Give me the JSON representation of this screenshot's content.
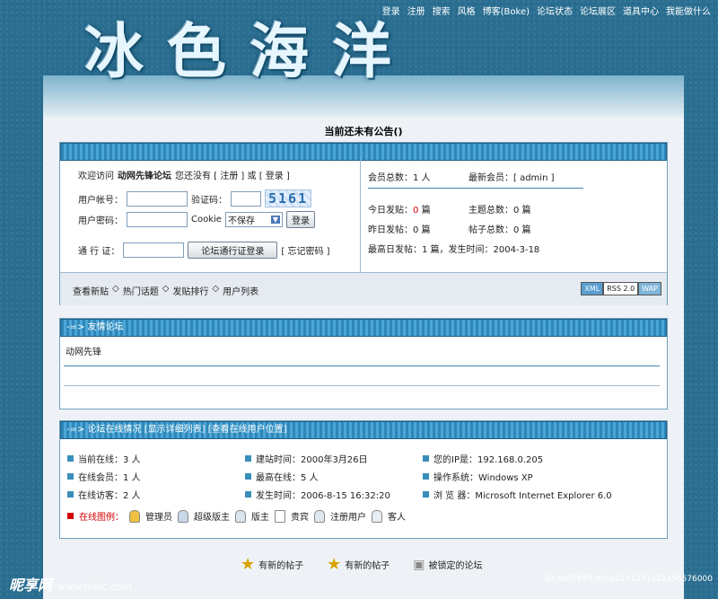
{
  "top_nav": [
    "登录",
    "注册",
    "搜索",
    "风格",
    "博客(Boke)",
    "论坛状态",
    "论坛展区",
    "道具中心",
    "我能做什么"
  ],
  "logo_chars": [
    "冰",
    "色",
    "海",
    "洋"
  ],
  "notice": "当前还未有公告()",
  "login": {
    "welcome_prefix": "欢迎访问",
    "forum_name": "动网先锋论坛",
    "welcome_suffix": "您还没有 [ 注册 ] 或 [ 登录 ]",
    "username_label": "用户帐号：",
    "captcha_label": "验证码：",
    "captcha_value": "5161",
    "password_label": "用户密码：",
    "cookie_label": "Cookie",
    "cookie_option": "不保存",
    "login_button": "登录",
    "passport_label": "通 行 证：",
    "passport_button": "论坛通行证登录",
    "forgot_password": "[ 忘记密码 ]"
  },
  "stats": {
    "members": "会员总数：1 人",
    "newest_member": "最新会员：[ admin ]",
    "today_posts_label": "今日发贴：",
    "today_posts_value": "0",
    "today_posts_unit": "篇",
    "topics": "主题总数：0 篇",
    "yesterday_posts": "昨日发帖：0 篇",
    "posts_total": "帖子总数：0 篇",
    "max_day": "最高日发帖：1 篇，发生时间：2004-3-18"
  },
  "quick_links": [
    "查看新贴",
    "热门话题",
    "发贴排行",
    "用户列表"
  ],
  "quick_link_sep": "◇",
  "feed_badges": [
    "XML",
    "RSS 2.0",
    "WAP"
  ],
  "friend_section": {
    "title": "-=> 友情论坛",
    "item": "动网先锋"
  },
  "online_section": {
    "title": "-=> 论坛在线情况 [显示详细列表] [查看在线用户位置]",
    "cells": [
      [
        "当前在线：3 人",
        "建站时间：2000年3月26日",
        "您的IP是：192.168.0.205"
      ],
      [
        "在线会员：1 人",
        "最高在线：5 人",
        "操作系统：Windows XP"
      ],
      [
        "在线访客：2 人",
        "发生时间：2006-8-15 16:32:20",
        "浏 览 器：Microsoft Internet Explorer 6.0"
      ]
    ],
    "legend_label": "在线图例：",
    "legend": [
      "管理员",
      "超级版主",
      "版主",
      "贵宾",
      "注册用户",
      "客人"
    ]
  },
  "footer_legend": [
    "有新的帖子",
    "有新的帖子",
    "被锁定的论坛"
  ],
  "watermark_left": "昵享网",
  "watermark_left_url": "www.nipic.com",
  "watermark_right": "ID:5605889 NO:20131231022456576000",
  "colors": {
    "accent": "#3a8fba",
    "alert": "#d40000",
    "bar": "#2f86b8"
  }
}
